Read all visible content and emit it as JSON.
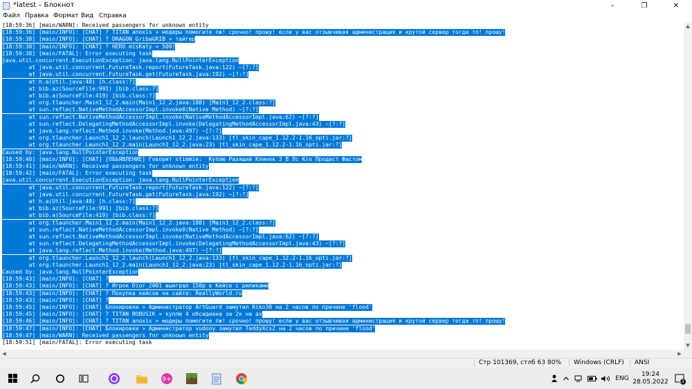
{
  "window": {
    "title": "*latest – Блокнот",
    "minimize_glyph": "–",
    "maximize_glyph": "❐",
    "close_glyph": "✕"
  },
  "menu": {
    "file": "Файл",
    "edit": "Правка",
    "format": "Формат",
    "view": "Вид",
    "help": "Справка"
  },
  "log_lines": [
    {
      "text": "[18:59:36] [main/WARN]: Received passengers for unknown entity",
      "selected": false
    },
    {
      "text": "[18:59:36] [main/INFO]: [CHAT] ? TITAN anoxis » модеры помогите пж! срочно! прошу! если у вас отзывчивая администрация и крутой сервер тогда тп! прошу!",
      "selected": true
    },
    {
      "text": "[18:59:38] [main/INFO]: [CHAT] ? DRAGON GribaGRIB » тайгер",
      "selected": true
    },
    {
      "text": "[18:59:38] [main/INFO]: [CHAT] ? HERO misKaty » 500!",
      "selected": true
    },
    {
      "text": "[18:59:38] [main/FATAL]: Error executing task",
      "selected": true
    },
    {
      "text": "java.util.concurrent.ExecutionException: java.lang.NullPointerException",
      "selected": true
    },
    {
      "text": "        at java.util.concurrent.FutureTask.report(FutureTask.java:122) ~[?:?]",
      "selected": true
    },
    {
      "text": "        at java.util.concurrent.FutureTask.get(FutureTask.java:192) ~[?:?]",
      "selected": true
    },
    {
      "text": "        at h.a(Util.java:48) [h.class:?]",
      "selected": true
    },
    {
      "text": "        at bib.az(SourceFile:991) [bib.class:?]",
      "selected": true
    },
    {
      "text": "        at bib.a(SourceFile:419) [bib.class:?]",
      "selected": true
    },
    {
      "text": "        at org.tlauncher.Main1_12_2.main(Main1_12_2.java:188) [Main1_12_2.class:?]",
      "selected": true
    },
    {
      "text": "        at sun.reflect.NativeMethodAccessorImpl.invoke0(Native Method) ~[?:?]",
      "selected": true
    },
    {
      "text": "        at sun.reflect.NativeMethodAccessorImpl.invoke(NativeMethodAccessorImpl.java:62) ~[?:?]",
      "selected": true
    },
    {
      "text": "        at sun.reflect.DelegatingMethodAccessorImpl.invoke(DelegatingMethodAccessorImpl.java:43) ~[?:?]",
      "selected": true
    },
    {
      "text": "        at java.lang.reflect.Method.invoke(Method.java:497) ~[?:?]",
      "selected": true
    },
    {
      "text": "        at org.tlauncher.Launch1_12_2.launch(Launch1_12_2.java:133) [tl_skin_cape_1.12.2-1.16_opti.jar:?]",
      "selected": true
    },
    {
      "text": "        at org.tlauncher.Launch1_12_2.main(Launch1_12_2.java:23) [tl_skin_cape_1.12.2-1.16_opti.jar:?]",
      "selected": true
    },
    {
      "text": "Caused by: java.lang.NullPointerException",
      "selected": true
    },
    {
      "text": "[18:59:40] [main/INFO]: [CHAT] [ОБЬЯВЛЕНИЕ] Говорит stimmie:  Куплю Разящий Клинок 3 В Лс Кто Продаст Фастом",
      "selected": true
    },
    {
      "text": "[18:59:41] [main/WARN]: Received passengers for unknown entity",
      "selected": true
    },
    {
      "text": "[18:59:42] [main/FATAL]: Error executing task",
      "selected": true
    },
    {
      "text": "java.util.concurrent.ExecutionException: java.lang.NullPointerException",
      "selected": true
    },
    {
      "text": "        at java.util.concurrent.FutureTask.report(FutureTask.java:122) ~[?:?]",
      "selected": true
    },
    {
      "text": "        at java.util.concurrent.FutureTask.get(FutureTask.java:192) ~[?:?]",
      "selected": true
    },
    {
      "text": "        at h.a(Util.java:48) [h.class:?]",
      "selected": true
    },
    {
      "text": "        at bib.az(SourceFile:991) [bib.class:?]",
      "selected": true
    },
    {
      "text": "        at bib.a(SourceFile:419) [bib.class:?]",
      "selected": true
    },
    {
      "text": "        at org.tlauncher.Main1_12_2.main(Main1_12_2.java:188) [Main1_12_2.class:?]",
      "selected": true
    },
    {
      "text": "        at sun.reflect.NativeMethodAccessorImpl.invoke0(Native Method) ~[?:?]",
      "selected": true
    },
    {
      "text": "        at sun.reflect.NativeMethodAccessorImpl.invoke(NativeMethodAccessorImpl.java:62) ~[?:?]",
      "selected": true
    },
    {
      "text": "        at sun.reflect.DelegatingMethodAccessorImpl.invoke(DelegatingMethodAccessorImpl.java:43) ~[?:?]",
      "selected": true
    },
    {
      "text": "        at java.lang.reflect.Method.invoke(Method.java:497) ~[?:?]",
      "selected": true
    },
    {
      "text": "        at org.tlauncher.Launch1_12_2.launch(Launch1_12_2.java:133) [tl_skin_cape_1.12.2-1.16_opti.jar:?]",
      "selected": true
    },
    {
      "text": "        at org.tlauncher.Launch1_12_2.main(Launch1_12_2.java:23) [tl_skin_cape_1.12.2-1.16_opti.jar:?]",
      "selected": true
    },
    {
      "text": "Caused by: java.lang.NullPointerException",
      "selected": true
    },
    {
      "text": "[18:59:43] [main/INFO]: [CHAT] ?",
      "selected": true
    },
    {
      "text": "[18:59:43] [main/INFO]: [CHAT] ? Игрок Dior_2001 выиграл 150р в Кейсе с риликами",
      "selected": true
    },
    {
      "text": "[18:59:43] [main/INFO]: [CHAT] ? Покупка кейсов на сайте: ReallyWorld.ru",
      "selected": true
    },
    {
      "text": "[18:59:43] [main/INFO]: [CHAT] ?",
      "selected": true
    },
    {
      "text": "[18:59:45] [main/INFO]: [CHAT] Блокировки » Администратор ArtGuard замутил Riko30 на 2 часов по причине 'flood'",
      "selected": true
    },
    {
      "text": "[18:59:45] [main/INFO]: [CHAT] ? TITAN BOBUSIK » куплю 4 обсидиана за 2к на ах",
      "selected": true
    },
    {
      "text": "[18:59:46] [main/INFO]: [CHAT] ? TITAN anoxis » модеры помогите пж! срочно! прошу! если у вас отзывчивая администрация и крутой сервер тогда тп! прошу!",
      "selected": true
    },
    {
      "text": "[18:59:47] [main/INFO]: [CHAT] Блокировки » Администратор vudooy замутил TeddyXcs2 на 2 часов по причине 'flood'",
      "selected": true
    },
    {
      "text": "[18:59:47] [main/WARN]: Received passengers for unknown entity",
      "selected": true
    },
    {
      "text": "[18:59:51] [main/FATAL]: Error executing task",
      "selected": false
    }
  ],
  "scroll": {
    "up_glyph": "▲",
    "down_glyph": "▼",
    "left_glyph": "◀",
    "right_glyph": "▶"
  },
  "status": {
    "position": "Стр 101369, стлб 63",
    "zoom": "80%",
    "line_endings": "Windows (CRLF)",
    "encoding": "ANSI"
  },
  "taskbar": {
    "icons": [
      "windows-start-icon",
      "search-icon",
      "cortana-icon",
      "task-view-icon",
      "alice-assistant-icon",
      "file-explorer-icon",
      "app-plus-icon",
      "minecraft-icon",
      "notepad-icon",
      "chrome-icon"
    ],
    "time": "19:24",
    "date": "28.05.2022",
    "language": "ENG",
    "notifications": "13"
  },
  "colors": {
    "selection": "#0078d7",
    "taskbar": "#ececec",
    "accent": "#0078d7"
  }
}
